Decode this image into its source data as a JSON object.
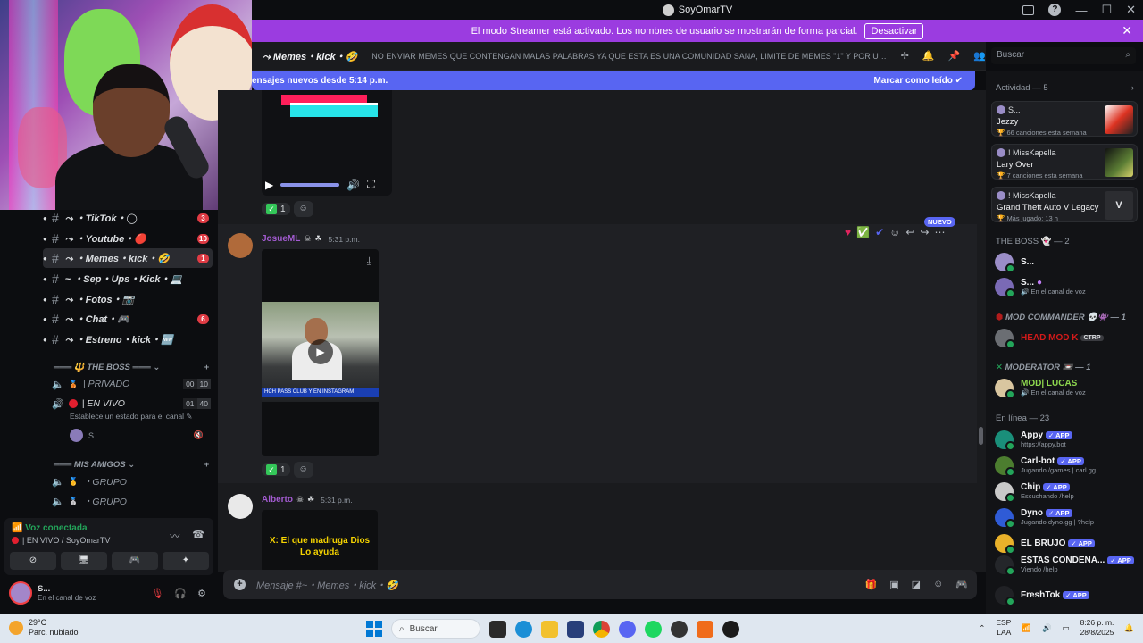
{
  "window": {
    "title": "SoyOmarTV"
  },
  "streamer_banner": {
    "text": "El modo Streamer está activado. Los nombres de usuario se mostrarán de forma parcial.",
    "button": "Desactivar",
    "close": "✕"
  },
  "channels": [
    {
      "name": "TikTok",
      "emoji": "◯",
      "badge": "3"
    },
    {
      "name": "Youtube",
      "emoji": "🔴",
      "badge": "10"
    },
    {
      "name": "Memes・kick",
      "emoji": "🤣",
      "badge": "1",
      "active": true
    },
    {
      "name": "Sep・Ups・Kick",
      "emoji": "💻",
      "badge": ""
    },
    {
      "name": "Fotos",
      "emoji": "📷",
      "badge": ""
    },
    {
      "name": "Chat",
      "emoji": "🎮",
      "badge": "6"
    },
    {
      "name": "Estreno・kick",
      "emoji": "🆕",
      "badge": ""
    }
  ],
  "voice_categories": {
    "boss": "THE BOSS",
    "friends": "MIS AMIGOS"
  },
  "voice_channels": {
    "privado": {
      "name": "| PRIVADO",
      "count_a": "00",
      "count_b": "10"
    },
    "en_vivo": {
      "name": "| EN VIVO",
      "count_a": "01",
      "count_b": "40"
    },
    "status_prompt": "Establece un estado para el canal",
    "user": "S...",
    "grupo1": "・GRUPO",
    "grupo2": "・GRUPO"
  },
  "voice_panel": {
    "status": "Voz conectada",
    "channel": "| EN VIVO / SoyOmarTV"
  },
  "user_bar": {
    "name": "S...",
    "sub": "En el canal de voz"
  },
  "header": {
    "channel_name": "Memes・kick・🤣",
    "topic": "NO ENVIAR MEMES QUE CONTENGAN MALAS PALABRAS YA QUE ESTA ES UNA COMUNIDAD SANA, LIMITE DE MEMES \"1\" Y POR ULTIMO EL ...",
    "search_placeholder": "Buscar"
  },
  "new_messages_bar": {
    "text": "ensajes nuevos desde 5:14 p.m.",
    "action": "Marcar como leído"
  },
  "messages": [
    {
      "author": "",
      "reaction_count": "1"
    },
    {
      "author": "JosueML",
      "time": "5:31 p.m.",
      "reaction_count": "1",
      "video_caption": "HCH  PASS CLUB    Y EN INSTAGRAM"
    },
    {
      "author": "Alberto",
      "time": "5:31 p.m.",
      "video_text_1": "X: El que madruga Dios",
      "video_text_2": "Lo ayuda"
    }
  ],
  "hover_badge": "NUEVO",
  "composer": {
    "placeholder": "Mensaje #~・Memes・kick・🤣"
  },
  "activity": {
    "header": "Actividad — 5",
    "cards": [
      {
        "user": "S...",
        "title": "Jezzy",
        "sub": "66 canciones esta semana"
      },
      {
        "user": "! MissKapella",
        "title": "Lary Over",
        "sub": "7 canciones esta semana"
      },
      {
        "user": "! MissKapella",
        "title": "Grand Theft Auto V Legacy",
        "sub": "Más jugado: 13 h"
      }
    ]
  },
  "member_sections": {
    "boss": "THE BOSS 👻 — 2",
    "mod_commander": "MOD COMMANDER 💀👾 — 1",
    "moderator": "MODERATOR 📼 — 1",
    "online": "En línea — 23"
  },
  "members": {
    "boss1": {
      "name": "S...",
      "sub": ""
    },
    "boss2": {
      "name": "S...",
      "sub": "En el canal de voz"
    },
    "head_mod": {
      "name": "HEAD MOD K",
      "tag": "CTRP"
    },
    "mod_lucas": {
      "name": "MOD| LUCAS",
      "sub": "En el canal de voz"
    },
    "online": [
      {
        "name": "Appy",
        "sub": "https://appy.bot"
      },
      {
        "name": "Carl-bot",
        "sub": "Jugando /games | carl.gg"
      },
      {
        "name": "Chip",
        "sub": "Escuchando /help"
      },
      {
        "name": "Dyno",
        "sub": "Jugando dyno.gg | ?help"
      },
      {
        "name": "EL BRUJO",
        "sub": ""
      },
      {
        "name": "ESTAS CONDENA...",
        "sub": "Viendo /help"
      },
      {
        "name": "FreshTok",
        "sub": ""
      }
    ],
    "app_label": "✓ APP"
  },
  "taskbar": {
    "temp": "29°C",
    "weather": "Parc. nublado",
    "search": "Buscar",
    "lang_1": "ESP",
    "lang_2": "LAA",
    "time": "8:26 p. m.",
    "date": "28/8/2025"
  },
  "colors": {
    "streamer_purple": "#9b3ce0",
    "blurple": "#5865f2",
    "badge_red": "#e03b44",
    "online_green": "#23a55a",
    "username_purple": "#a35bd1"
  }
}
